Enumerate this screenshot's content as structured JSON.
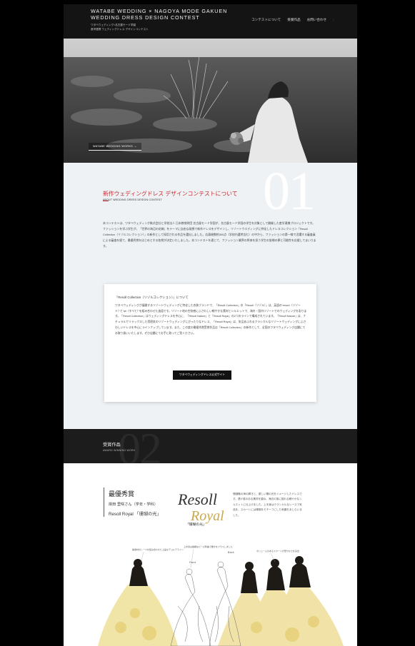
{
  "header": {
    "title_line1": "WATABE WEDDING × NAGOYA MODE GAKUEN",
    "title_line2": "WEDDING DRESS DESIGN CONTEST",
    "sub_line1": "ワタベウェディング×名古屋モード学園",
    "sub_line2": "産学連携 ウェディングドレス デザインコンテスト"
  },
  "nav": {
    "items": [
      "コンテストについて",
      "受賞作品",
      "お問い合わせ"
    ],
    "arrow": "›"
  },
  "hero": {
    "caption": "WATABE WEDDING WORKS →"
  },
  "about": {
    "number": "01",
    "title": "新作ウェディングドレス デザインコンテストについて",
    "subtitle": "ABOUT WEDDING DRESS DESIGN CONTEST",
    "paragraph": "本コンテストは、ワタベウェディング株式会社と学校法人 日本教育財団 名古屋モード学園が、名古屋モード学園の学生を対象として開催した産学連携プロジェクトです。ファッションを学ぶ学生が、「世界の海辺の花嫁」をテーマに自由な発想で新作ドレスをデザインし、リゾートウエディングに特化したドレスコレクション「Resoll Collection（リゾルコレクション）」の新作として採用される作品を選出しました。応募総数約300点（学校内選考含む）の中から、ファッションの第一線で活躍する審査員による審査を経て、最優秀賞をはじめとする各賞が決定いたしました。本コンテストを通じて、ファッション業界の将来を担う学生の皆様の夢と可能性を応援してまいります。",
    "card": {
      "title": "「Resoll Collection（リゾルコレクション）」について",
      "body": "ワタベウェディングが展開するリゾートウェディングに特化した衣装ブランドで、「Resoll Collection」の「Resoll（リゾル）」は、英語の“resort（リゾート）”と“all（すべて）”を組み合わせた造語です。リゾート地の空気感にふさわしい軽やかな素材とシルエットで、海外・国内リゾートでのウェディングを彩ります。「Resoll Collection」はウェディングドレスを中心に、「Resoll Nature」と「Resoll Royal」の2つのラインで構成されています。「Resoll Nature」は、ナチュラルでリラックスした雰囲気のリゾートウェディングにぴったりなドレス、「Resoll Royal」は、気品あふれるクラシカルなリゾートウェディングにふさわしいドレスを中心にラインナップしています。また、この度の最優秀賞受賞作品は「Resoll Collection」の新作として、全国のワタベウェディング店舗にてお取り扱いいたします。ぜひ店舗にてお手に取ってご覧ください。",
      "button": "ワタベウェディングドレス公式サイト"
    }
  },
  "works": {
    "number": "02",
    "title": "受賞作品",
    "subtitle": "AWARD WINNING WORK"
  },
  "award": {
    "rank": "最優秀賞",
    "student": "岸田 里咲さん（学年・学科）",
    "work": "Resoll Royal 「珊瑚の光」",
    "logo_line1": "Resoll",
    "logo_line2": "Royal",
    "logo_caption": "「珊瑚の光」",
    "description": "珊瑚礁の海の輝きと、優しい陽の光をイメージしたドレスです。透け感のある素材を重ね、海辺の風に揺れる軽やかなシルエットに仕上げました。上半身はクラシカルなレースで気品を、スカートには珊瑚をモチーフにした刺繍をあしらいました。",
    "note1": "異素材のレースを組み合わせた上品なデコルテライン",
    "note2": "上半身は繊細なビーズ刺繍で輝きをプラスしました",
    "note3": "Front",
    "note4": "Back",
    "note5": "ボリュームのあるスカートが華やかさを演出"
  },
  "colors": {
    "accent": "#c9282d",
    "header_bg": "#141414",
    "section_bg": "#eef2f4",
    "gold": "#e7cf7a"
  }
}
